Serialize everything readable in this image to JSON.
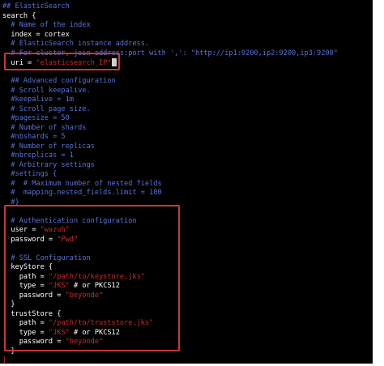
{
  "editor": {
    "lines": [
      {
        "t": "c",
        "text": "## ElasticSearch"
      },
      {
        "t": "k",
        "text": "search {"
      },
      {
        "t": "c",
        "text": "  # Name of the index"
      },
      {
        "t": "k",
        "text": "  index = cortex"
      },
      {
        "t": "c",
        "text": "  # ElasticSearch instance address."
      },
      {
        "t": "c",
        "text": "  # For cluster, join address:port with ',': \"http://ip1:9200,ip2:9200,ip3:9200\""
      },
      {
        "t": "kv",
        "key": "  uri = ",
        "val": "\"elasticsearch_IP\"",
        "cursor": true
      },
      {
        "t": "blank",
        "text": ""
      },
      {
        "t": "c",
        "text": "  ## Advanced configuration"
      },
      {
        "t": "c",
        "text": "  # Scroll keepalive."
      },
      {
        "t": "c",
        "text": "  #keepalive = 1m"
      },
      {
        "t": "c",
        "text": "  # Scroll page size."
      },
      {
        "t": "c",
        "text": "  #pagesize = 50"
      },
      {
        "t": "c",
        "text": "  # Number of shards"
      },
      {
        "t": "c",
        "text": "  #nbshards = 5"
      },
      {
        "t": "c",
        "text": "  # Number of replicas"
      },
      {
        "t": "c",
        "text": "  #nbreplicas = 1"
      },
      {
        "t": "c",
        "text": "  # Arbitrary settings"
      },
      {
        "t": "c",
        "text": "  #settings {"
      },
      {
        "t": "c",
        "text": "  #  # Maximum number of nested fields"
      },
      {
        "t": "c",
        "text": "  #  mapping.nested_fields.limit = 100"
      },
      {
        "t": "c",
        "text": "  #}"
      },
      {
        "t": "blank",
        "text": ""
      },
      {
        "t": "c",
        "text": "  # Authentication configuration"
      },
      {
        "t": "kv",
        "key": "  user = ",
        "val": "\"wazuh\""
      },
      {
        "t": "kv",
        "key": "  password = ",
        "val": "\"Pwd\""
      },
      {
        "t": "blank",
        "text": ""
      },
      {
        "t": "c",
        "text": "  # SSL Configuration"
      },
      {
        "t": "k",
        "text": "  keyStore {"
      },
      {
        "t": "kv",
        "key": "    path = ",
        "val": "\"/path/to/keystore.jks\""
      },
      {
        "t": "kvc",
        "key": "    type = ",
        "val": "\"JKS\"",
        "comment": " # or PKCS12"
      },
      {
        "t": "kv",
        "key": "    password = ",
        "val": "\"beyonde\""
      },
      {
        "t": "k",
        "text": "  }"
      },
      {
        "t": "k",
        "text": "  trustStore {"
      },
      {
        "t": "kv",
        "key": "    path = ",
        "val": "\"/path/to/truststore.jks\""
      },
      {
        "t": "kvc",
        "key": "    type = ",
        "val": "\"JKS\"",
        "comment": " # or PKCS12"
      },
      {
        "t": "kv",
        "key": "    password = ",
        "val": "\"beyonde\""
      },
      {
        "t": "k",
        "text": "  }"
      },
      {
        "t": "end",
        "text": "}"
      }
    ]
  },
  "highlights": [
    {
      "name": "uri-highlight-box"
    },
    {
      "name": "auth-ssl-highlight-box"
    }
  ],
  "colors": {
    "background": "#000000",
    "comment": "#5a73d8",
    "string": "#cc2b2b",
    "text": "#ffffff",
    "highlight_border": "#c83838"
  }
}
